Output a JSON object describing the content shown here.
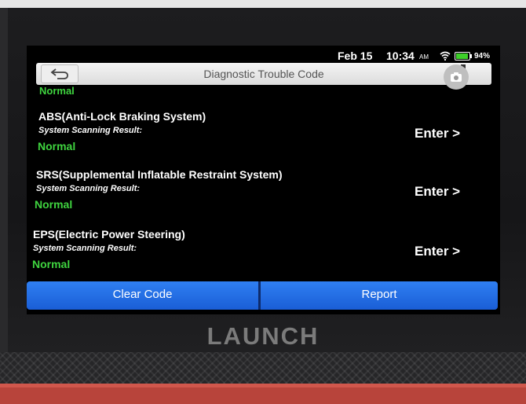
{
  "status_bar": {
    "date": "Feb 15",
    "time": "10:34",
    "ampm": "AM",
    "battery_percent": "94%",
    "battery_level": 0.94,
    "icons": [
      "wifi-icon",
      "battery-icon"
    ]
  },
  "header": {
    "title": "Diagnostic Trouble Code",
    "back_icon": "back-arrow-icon",
    "screenshot_icon": "camera-icon"
  },
  "top_partial_status": "Normal",
  "systems": [
    {
      "name": "ABS(Anti-Lock Braking System)",
      "label": "System Scanning Result:",
      "status": "Normal",
      "enter": "Enter >"
    },
    {
      "name": "SRS(Supplemental Inflatable Restraint System)",
      "label": "System Scanning Result:",
      "status": "Normal",
      "enter": "Enter >"
    },
    {
      "name": "EPS(Electric Power Steering)",
      "label": "System Scanning Result:",
      "status": "Normal",
      "enter": "Enter >"
    }
  ],
  "actions": {
    "clear_code": "Clear Code",
    "report": "Report"
  },
  "device": {
    "brand": "LAUNCH"
  },
  "colors": {
    "status_normal": "#3fd43f",
    "button_blue": "#2f7ff2",
    "screen_bg": "#000000",
    "case_red": "#b8443b"
  }
}
